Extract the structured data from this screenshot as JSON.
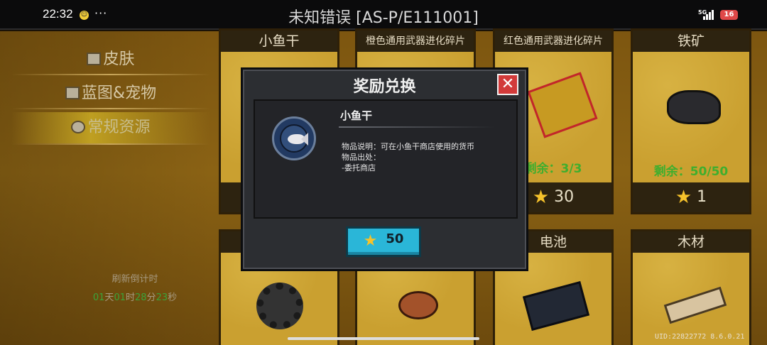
{
  "status_bar": {
    "time": "22:32",
    "more": "···",
    "title": "未知错误 [AS-P/E111001]",
    "network": "5G",
    "battery": "16"
  },
  "sidebar": {
    "items": [
      {
        "label": "皮肤",
        "icon": "shirt-icon",
        "active": false
      },
      {
        "label": "蓝图&宠物",
        "icon": "blueprint-icon",
        "active": false
      },
      {
        "label": "常规资源",
        "icon": "resource-icon",
        "active": true
      }
    ],
    "refresh_label": "刷新倒计时",
    "refresh": {
      "d": "01",
      "d_unit": "天",
      "h": "01",
      "h_unit": "时",
      "m": "28",
      "m_unit": "分",
      "s": "23",
      "s_unit": "秒"
    }
  },
  "grid": {
    "top_row": [
      {
        "name": "小鱼干",
        "remain": "",
        "price": ""
      },
      {
        "name": "橙色通用武器进化碎片",
        "remain": "",
        "price": ""
      },
      {
        "name": "红色通用武器进化碎片",
        "remain": "剩余：3/3",
        "price": "30"
      },
      {
        "name": "铁矿",
        "remain": "剩余：50/50",
        "price": "1"
      }
    ],
    "bottom_row": [
      {
        "name": "",
        "icon": "gear-icon"
      },
      {
        "name": "",
        "icon": "ore-icon"
      },
      {
        "name": "电池",
        "icon": "battery-icon"
      },
      {
        "name": "木材",
        "icon": "wood-icon"
      }
    ]
  },
  "modal": {
    "title": "奖励兑换",
    "close": "✕",
    "item_name": "小鱼干",
    "desc_line1": "物品说明：可在小鱼干商店使用的货币",
    "desc_line2": "物品出处：",
    "desc_line3": "-委托商店",
    "price": "50"
  },
  "footer": {
    "uid": "UID:22822772 8.6.0.21"
  },
  "colors": {
    "accent_cyan": "#2ab6d8",
    "close_red": "#d23a3a",
    "remain_green": "#3fae2e",
    "star_gold": "#f6c22b"
  }
}
